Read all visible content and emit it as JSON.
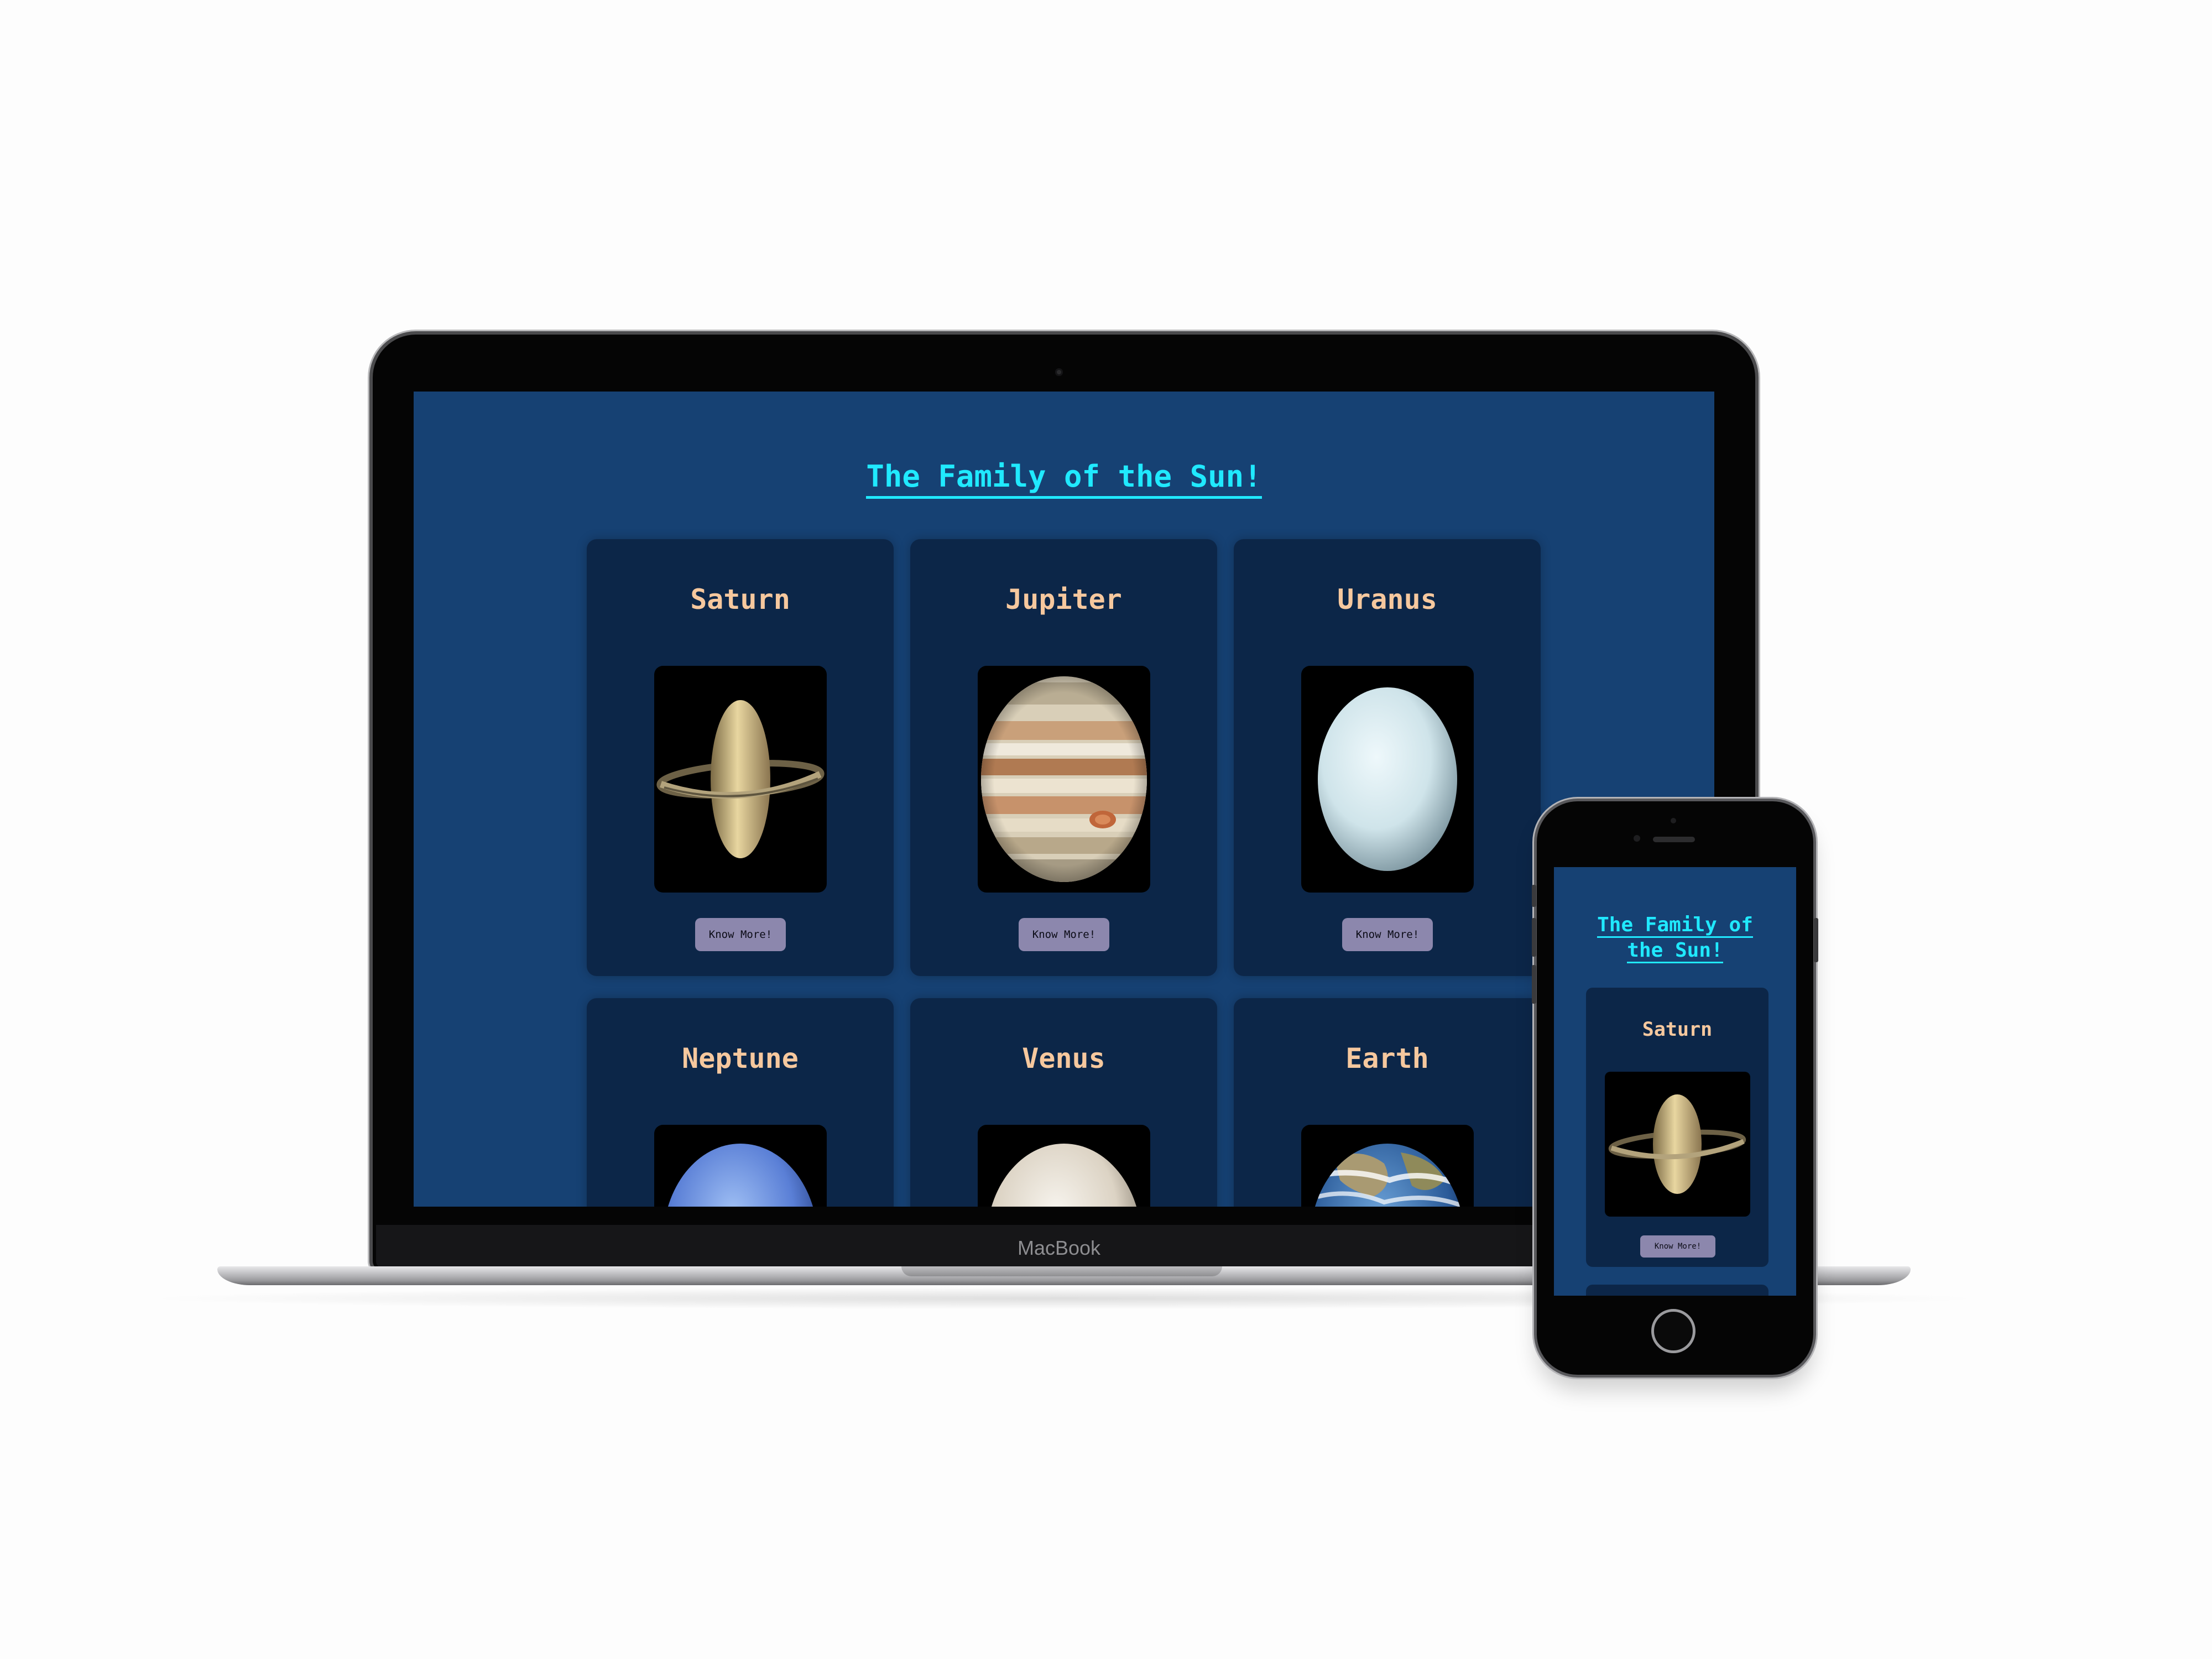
{
  "laptop": {
    "brand_label": "MacBook"
  },
  "site": {
    "title": "The Family of the Sun!",
    "button_label": "Know More!",
    "cards": [
      {
        "name": "Saturn",
        "image": "saturn-image"
      },
      {
        "name": "Jupiter",
        "image": "jupiter-image"
      },
      {
        "name": "Uranus",
        "image": "uranus-image"
      },
      {
        "name": "Neptune",
        "image": "neptune-image"
      },
      {
        "name": "Venus",
        "image": "venus-image"
      },
      {
        "name": "Earth",
        "image": "earth-image"
      }
    ]
  },
  "mobile": {
    "title_line1": "The Family of",
    "title_line2": "the Sun!",
    "card_name": "Saturn",
    "button_label": "Know More!"
  },
  "colors": {
    "page_background": "#164173",
    "card_background": "#0c2648",
    "title_accent": "#20e9ff",
    "card_name": "#f6c89e",
    "button": "#8c87ad"
  }
}
